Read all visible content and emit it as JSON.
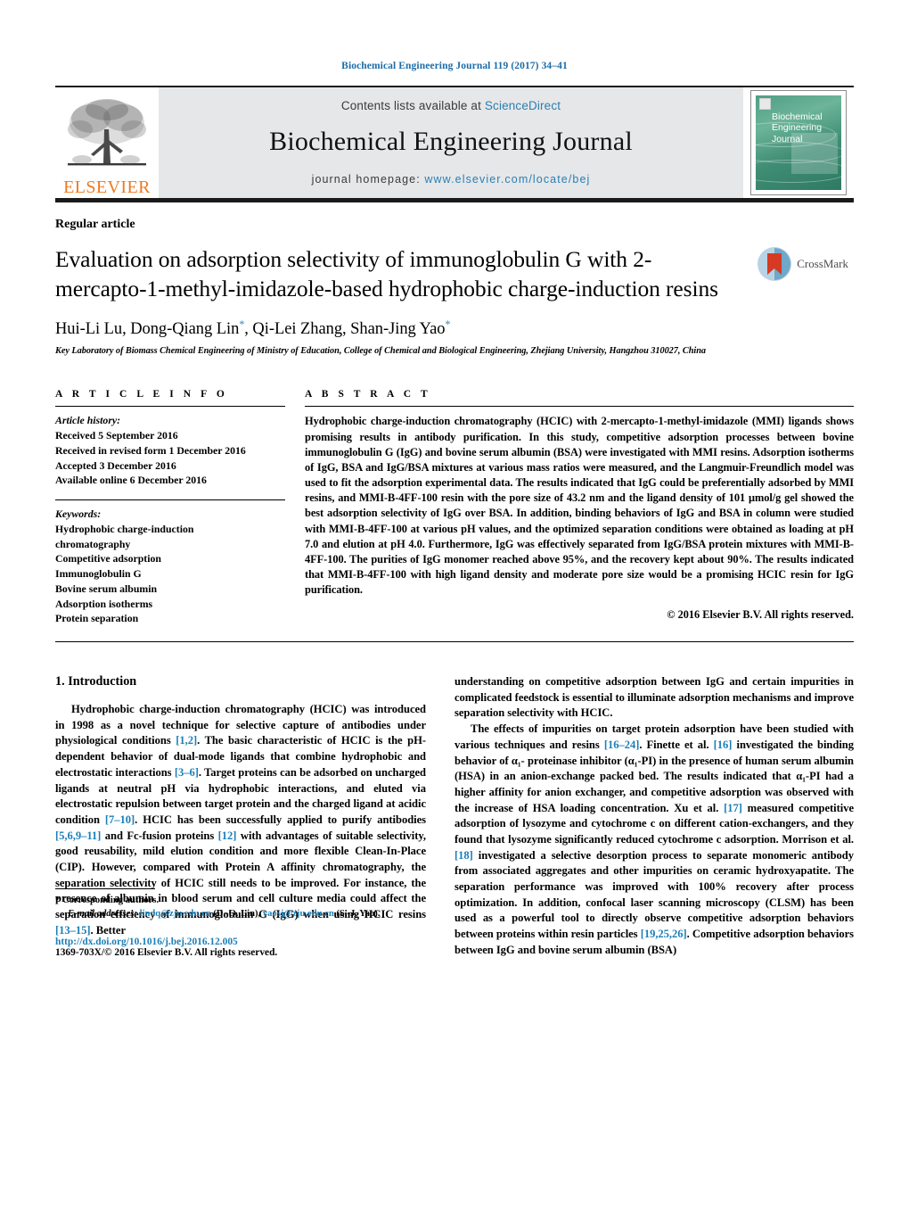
{
  "running_head": "Biochemical Engineering Journal 119 (2017) 34–41",
  "masthead": {
    "contents_prefix": "Contents lists available at ",
    "sciencedirect": "ScienceDirect",
    "journal_name": "Biochemical Engineering Journal",
    "homepage_label": "journal homepage:",
    "homepage_url": "www.elsevier.com/locate/bej",
    "publisher_wordmark": "ELSEVIER",
    "cover_title_lines": [
      "Biochemical",
      "Engineering",
      "Journal"
    ],
    "accent_orange": "#ee7a23",
    "link_blue": "#2a7fb5",
    "band_gray": "#e6e7e8"
  },
  "article": {
    "type_label": "Regular article",
    "title": "Evaluation on adsorption selectivity of immunoglobulin G with 2-mercapto-1-methyl-imidazole-based hydrophobic charge-induction resins",
    "crossmark_label": "CrossMark",
    "authors_html": "Hui-Li Lu, Dong-Qiang Lin*, Qi-Lei Zhang, Shan-Jing Yao*",
    "affiliation": "Key Laboratory of Biomass Chemical Engineering of Ministry of Education, College of Chemical and Biological Engineering, Zhejiang University, Hangzhou 310027, China"
  },
  "article_info": {
    "heading": "A R T I C L E  I N F O",
    "history_label": "Article history:",
    "history": [
      "Received 5 September 2016",
      "Received in revised form 1 December 2016",
      "Accepted 3 December 2016",
      "Available online 6 December 2016"
    ],
    "keywords_label": "Keywords:",
    "keywords": [
      "Hydrophobic charge-induction",
      "chromatography",
      "Competitive adsorption",
      "Immunoglobulin G",
      "Bovine serum albumin",
      "Adsorption isotherms",
      "Protein separation"
    ]
  },
  "abstract": {
    "heading": "A B S T R A C T",
    "text": "Hydrophobic charge-induction chromatography (HCIC) with 2-mercapto-1-methyl-imidazole (MMI) ligands shows promising results in antibody purification. In this study, competitive adsorption processes between bovine immunoglobulin G (IgG) and bovine serum albumin (BSA) were investigated with MMI resins. Adsorption isotherms of IgG, BSA and IgG/BSA mixtures at various mass ratios were measured, and the Langmuir-Freundlich model was used to fit the adsorption experimental data. The results indicated that IgG could be preferentially adsorbed by MMI resins, and MMI-B-4FF-100 resin with the pore size of 43.2 nm and the ligand density of 101 μmol/g gel showed the best adsorption selectivity of IgG over BSA. In addition, binding behaviors of IgG and BSA in column were studied with MMI-B-4FF-100 at various pH values, and the optimized separation conditions were obtained as loading at pH 7.0 and elution at pH 4.0. Furthermore, IgG was effectively separated from IgG/BSA protein mixtures with MMI-B-4FF-100. The purities of IgG monomer reached above 95%, and the recovery kept about 90%. The results indicated that MMI-B-4FF-100 with high ligand density and moderate pore size would be a promising HCIC resin for IgG purification.",
    "copyright": "© 2016 Elsevier B.V. All rights reserved."
  },
  "introduction": {
    "section_title": "1.  Introduction",
    "left_paragraph_1_part1": "Hydrophobic charge-induction chromatography (HCIC) was introduced in 1998 as a novel technique for selective capture of antibodies under physiological conditions ",
    "ref_1_2": "[1,2]",
    "left_paragraph_1_part2": ". The basic characteristic of HCIC is the pH-dependent behavior of dual-mode ligands that combine hydrophobic and electrostatic interactions ",
    "ref_3_6": "[3–6]",
    "left_paragraph_1_part3": ". Target proteins can be adsorbed on uncharged ligands at neutral pH via hydrophobic interactions, and eluted via electrostatic repulsion between target protein and the charged ligand at acidic condition ",
    "ref_7_10": "[7–10]",
    "left_paragraph_1_part4": ". HCIC has been successfully applied to purify antibodies ",
    "ref_5_6_9_11": "[5,6,9–11]",
    "left_paragraph_1_part5": " and Fc-fusion proteins ",
    "ref_12": "[12]",
    "left_paragraph_1_part6": " with advantages of suitable selectivity, good reusability, mild elution condition and more flexible Clean-In-Place (CIP). However, compared with Protein A affinity chromatography, the separation selectivity of HCIC still needs to be improved. For instance, the presence of albumin in blood serum and cell culture media could affect the separation efficiency of immunoglobulin G (IgG) when using HCIC resins ",
    "ref_13_15": "[13–15]",
    "left_paragraph_1_part7": ". Better",
    "right_paragraph_1": "understanding on competitive adsorption between IgG and certain impurities in complicated feedstock is essential to illuminate adsorption mechanisms and improve separation selectivity with HCIC.",
    "right_paragraph_2_part1": "The effects of impurities on target protein adsorption have been studied with various techniques and resins ",
    "ref_16_24": "[16–24]",
    "right_paragraph_2_part2": ". Finette et al. ",
    "ref_16": "[16]",
    "right_paragraph_2_part3": " investigated the binding behavior of α₁- proteinase inhibitor (α₁-PI) in the presence of human serum albumin (HSA) in an anion-exchange packed bed. The results indicated that α₁-PI had a higher affinity for anion exchanger, and competitive adsorption was observed with the increase of HSA loading concentration. Xu et al. ",
    "ref_17": "[17]",
    "right_paragraph_2_part4": " measured competitive adsorption of lysozyme and cytochrome c on different cation-exchangers, and they found that lysozyme significantly reduced cytochrome c adsorption. Morrison et al. ",
    "ref_18": "[18]",
    "right_paragraph_2_part5": " investigated a selective desorption process to separate monomeric antibody from associated aggregates and other impurities on ceramic hydroxyapatite. The separation performance was improved with 100% recovery after process optimization. In addition, confocal laser scanning microscopy (CLSM) has been used as a powerful tool to directly observe competitive adsorption behaviors between proteins within resin particles ",
    "ref_19_25_26": "[19,25,26]",
    "right_paragraph_2_part6": ". Competitive adsorption behaviors between IgG and bovine serum albumin (BSA)"
  },
  "footnotes": {
    "corresponding_marker": "*",
    "corresponding_label": "Corresponding authors.",
    "email_label": "E-mail addresses:",
    "email_1": "lindq@zju.edu.cn",
    "email_1_owner": " (D.-Q. Lin), ",
    "email_2": "yaosj@zju.edu.cn",
    "email_2_owner": " (S.-J. Yao).",
    "doi": "http://dx.doi.org/10.1016/j.bej.2016.12.005",
    "issn_line": "1369-703X/© 2016 Elsevier B.V. All rights reserved."
  }
}
